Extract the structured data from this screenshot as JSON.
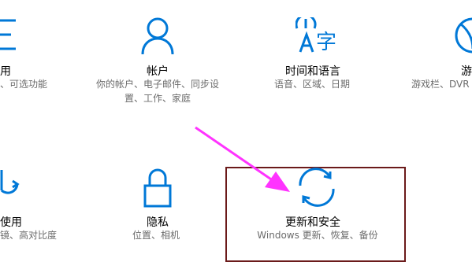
{
  "colors": {
    "accent": "#0078d7",
    "highlight_border": "#6b1a1a",
    "arrow": "#ff33ff"
  },
  "tiles": [
    {
      "name": "ease-of-access",
      "title": "用",
      "desc": "、可选功能",
      "icon": "list-icon"
    },
    {
      "name": "accounts",
      "title": "帐户",
      "desc": "你的帐户、电子邮件、同步设置、工作、家庭",
      "icon": "person-icon"
    },
    {
      "name": "time-language",
      "title": "时间和语言",
      "desc": "语音、区域、日期",
      "icon": "language-icon"
    },
    {
      "name": "gaming",
      "title": "游",
      "desc": "游戏栏、DVR",
      "icon": "xbox-icon"
    },
    {
      "name": "ease-of-use",
      "title": "使用",
      "desc": "镜、高对比度",
      "icon": "cursor-icon"
    },
    {
      "name": "privacy",
      "title": "隐私",
      "desc": "位置、相机",
      "icon": "lock-icon"
    },
    {
      "name": "update-security",
      "title": "更新和安全",
      "desc": "Windows 更新、恢复、备份",
      "icon": "sync-icon"
    }
  ]
}
